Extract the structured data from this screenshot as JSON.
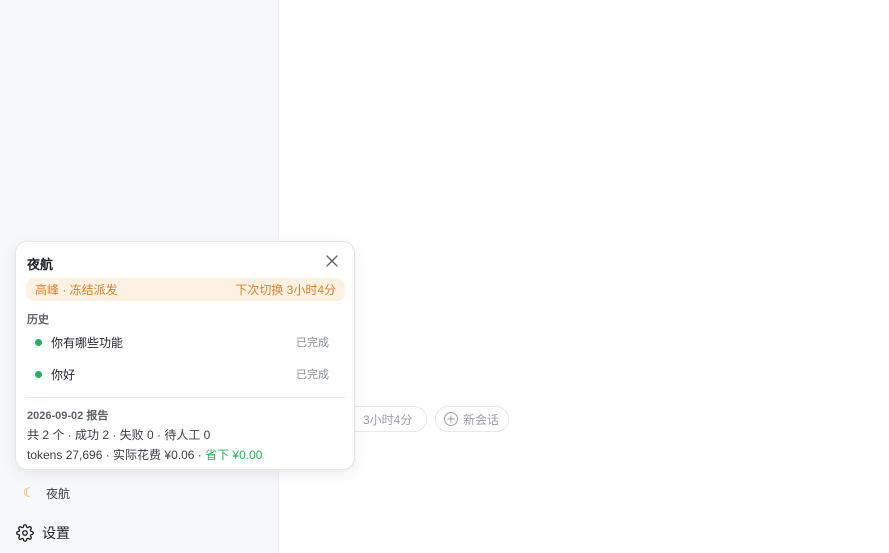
{
  "chips": {
    "timer_label": "3小时4分",
    "new_chat_label": "新会话"
  },
  "sidebar": {
    "nightflight_label": "夜航",
    "settings_label": "设置"
  },
  "popup": {
    "title": "夜航",
    "status_left": "高峰 · 冻结派发",
    "status_right": "下次切换 3小时4分",
    "history_label": "历史",
    "history": [
      {
        "text": "你有哪些功能",
        "status": "已完成"
      },
      {
        "text": "你好",
        "status": "已完成"
      }
    ],
    "report_title": "2026-09-02 报告",
    "report_line1": "共 2 个 · 成功 2 · 失败 0 · 待人工 0",
    "report_line2_prefix": "tokens 27,696 · 实际花费 ¥0.06 · ",
    "report_saved": "省下 ¥0.00"
  },
  "colors": {
    "accent_orange": "#d9822b",
    "status_bg": "#fdf1e3",
    "success_green": "#22b35e"
  }
}
